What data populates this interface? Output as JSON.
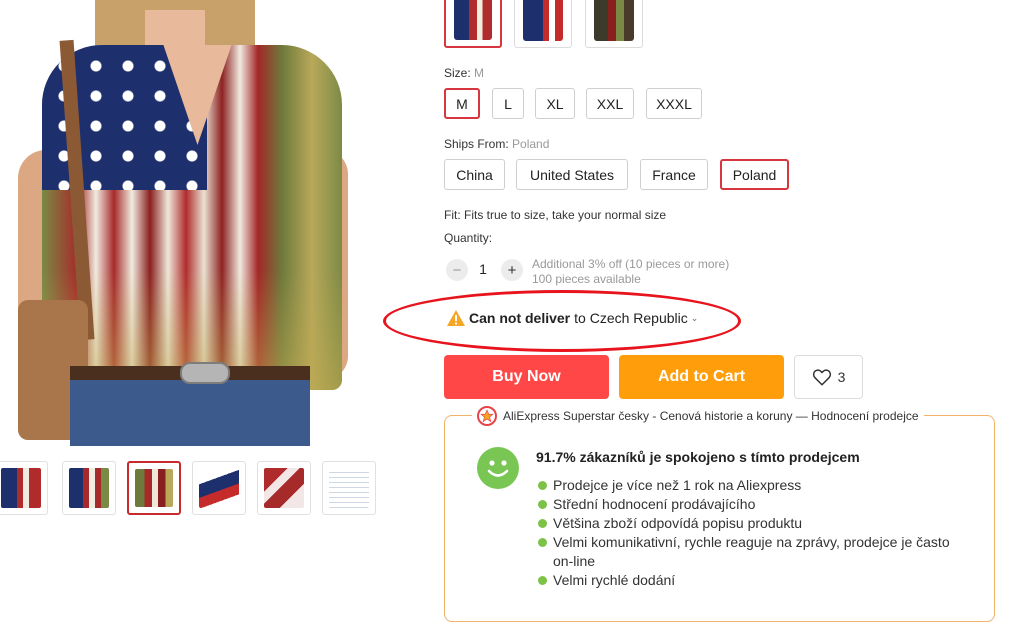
{
  "product": {
    "image_alt": "Women's V-neck T-shirt with distressed American flag print",
    "gallery_count": 6,
    "selected_gallery_index": 2
  },
  "color": {
    "variant_count": 3,
    "selected_index": 0
  },
  "size": {
    "label": "Size:",
    "selected": "M",
    "options": [
      "M",
      "L",
      "XL",
      "XXL",
      "XXXL"
    ]
  },
  "ships_from": {
    "label": "Ships From:",
    "selected": "Poland",
    "options": [
      "China",
      "United States",
      "France",
      "Poland"
    ]
  },
  "fit": "Fit: Fits true to size, take your normal size",
  "quantity": {
    "label": "Quantity:",
    "value": "1",
    "decrement_symbol": "−",
    "increment_symbol": "+",
    "discount_note": "Additional 3% off (10 pieces or more)",
    "available": "100 pieces available"
  },
  "delivery": {
    "status": "Can not deliver",
    "destination": "to Czech Republic",
    "chevron": "⌄"
  },
  "actions": {
    "buy_now": "Buy Now",
    "add_to_cart": "Add to Cart",
    "wishlist_count": "3"
  },
  "store": {
    "header": "AliExpress Superstar česky - Cenová historie a koruny — Hodnocení prodejce",
    "satisfaction": "91.7% zákazníků je spokojeno s tímto prodejcem",
    "points": [
      "Prodejce je více než 1 rok na Aliexpress",
      "Střední hodnocení prodávajícího",
      "Většina zboží odpovídá popisu produktu",
      "Velmi komunikativní, rychle reaguje na zprávy, prodejce je často on-line",
      "Velmi rychlé dodání"
    ]
  },
  "colors": {
    "accent_red": "#ff4747",
    "accent_orange": "#ff9d0a",
    "selected_border": "#d8363f",
    "annotation_red": "#e8141d",
    "positive_green": "#79c655"
  }
}
